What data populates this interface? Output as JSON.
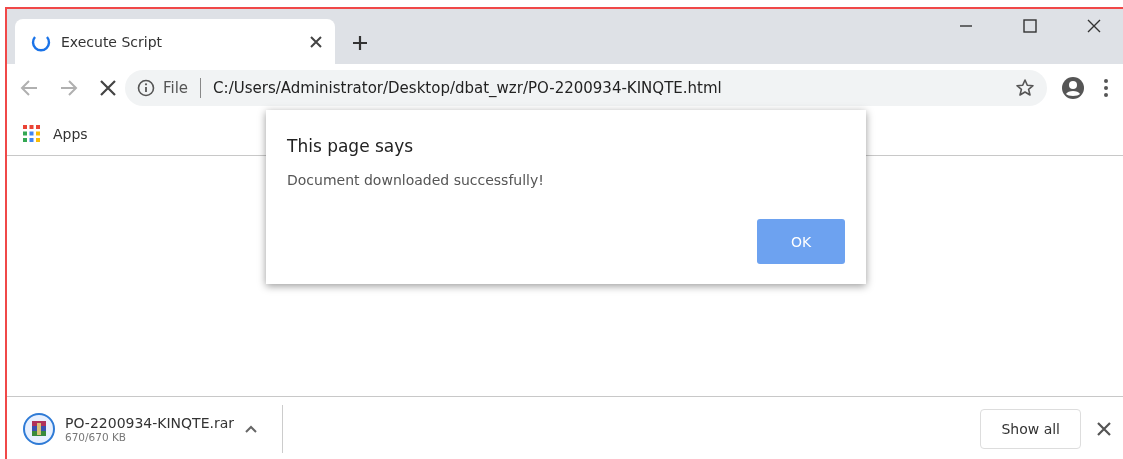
{
  "tabs": [
    {
      "title": "Execute Script",
      "loading": true,
      "selected": true
    }
  ],
  "toolbar": {
    "back_disabled": true,
    "forward_disabled": true,
    "site_label": "File",
    "url": "C:/Users/Administrator/Desktop/dbat_wzr/PO-2200934-KINQTE.html"
  },
  "bookmarks": [
    {
      "label": "Apps"
    }
  ],
  "dialog": {
    "title": "This page says",
    "message": "Document downloaded successfully!",
    "button": "OK"
  },
  "downloads": [
    {
      "filename": "PO-2200934-KINQTE.rar",
      "progress": "670/670 KB"
    }
  ],
  "download_bar": {
    "show_all": "Show all"
  }
}
